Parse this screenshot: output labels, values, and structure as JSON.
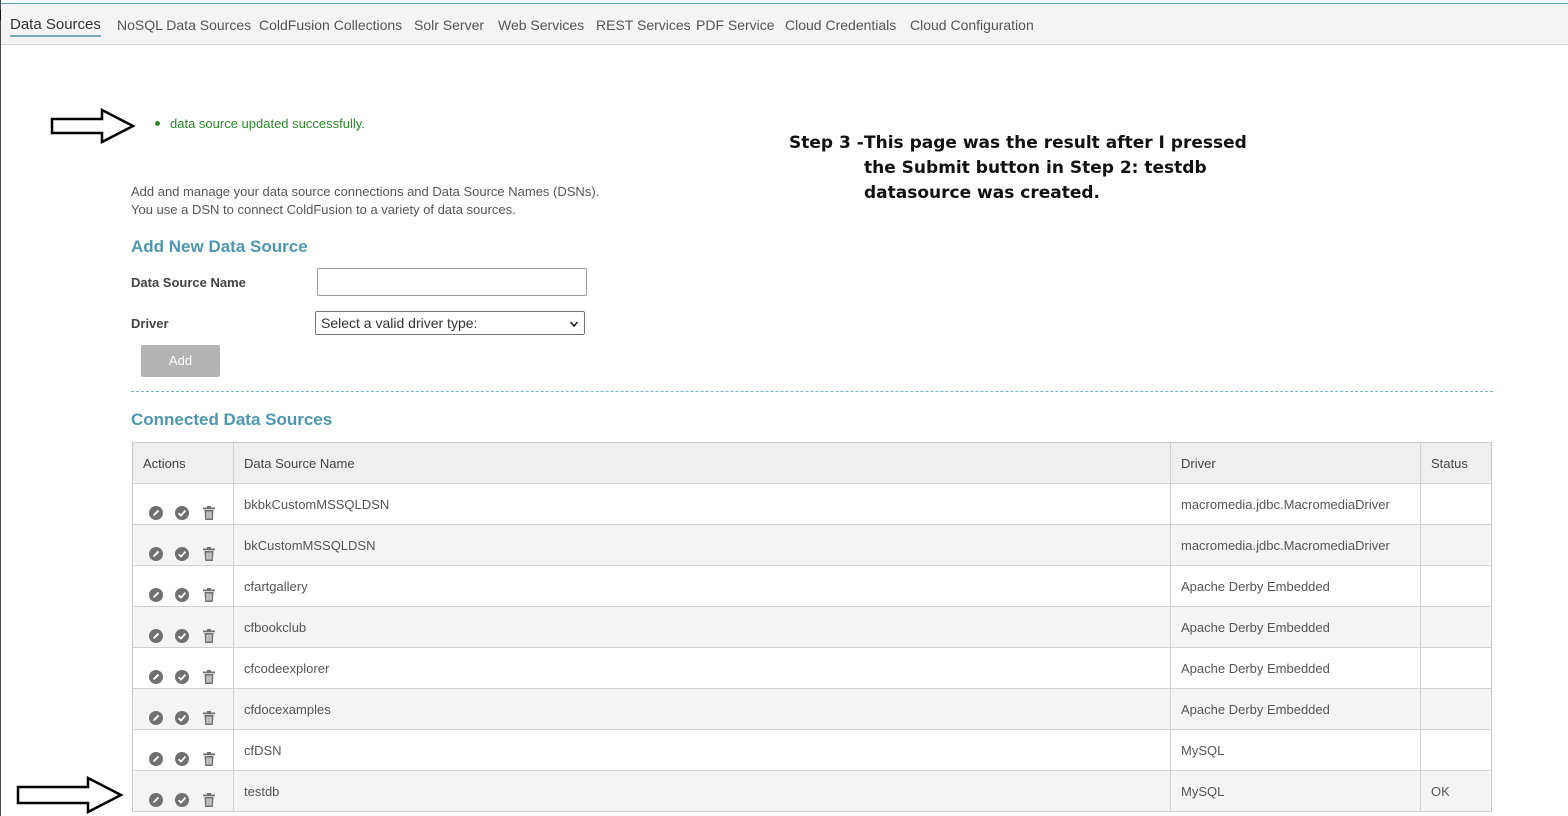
{
  "nav": {
    "tabs": [
      {
        "label": "Data Sources",
        "active": true
      },
      {
        "label": "NoSQL Data Sources"
      },
      {
        "label": "ColdFusion Collections"
      },
      {
        "label": "Solr Server"
      },
      {
        "label": "Web Services"
      },
      {
        "label": "REST Services"
      },
      {
        "label": "PDF Service"
      },
      {
        "label": "Cloud Credentials"
      },
      {
        "label": "Cloud Configuration"
      }
    ]
  },
  "message": {
    "success": "data source updated successfully."
  },
  "annotation": {
    "prefix": "Step 3 -",
    "text": "This page was the result after I pressed the Submit button in Step 2: testdb datasource was created."
  },
  "intro": {
    "line1": "Add and manage your data source connections and Data Source Names (DSNs).",
    "line2": "You use a DSN to connect ColdFusion to a variety of data sources."
  },
  "add_form": {
    "title": "Add New Data Source",
    "name_label": "Data Source Name",
    "name_value": "",
    "driver_label": "Driver",
    "driver_selected": "Select a valid driver type:",
    "add_button": "Add"
  },
  "connected": {
    "title": "Connected Data Sources",
    "columns": [
      "Actions",
      "Data Source Name",
      "Driver",
      "Status"
    ],
    "rows": [
      {
        "name": "bkbkCustomMSSQLDSN",
        "driver": "macromedia.jdbc.MacromediaDriver",
        "status": ""
      },
      {
        "name": "bkCustomMSSQLDSN",
        "driver": "macromedia.jdbc.MacromediaDriver",
        "status": ""
      },
      {
        "name": "cfartgallery",
        "driver": "Apache Derby Embedded",
        "status": ""
      },
      {
        "name": "cfbookclub",
        "driver": "Apache Derby Embedded",
        "status": ""
      },
      {
        "name": "cfcodeexplorer",
        "driver": "Apache Derby Embedded",
        "status": ""
      },
      {
        "name": "cfdocexamples",
        "driver": "Apache Derby Embedded",
        "status": ""
      },
      {
        "name": "cfDSN",
        "driver": "MySQL",
        "status": ""
      },
      {
        "name": "testdb",
        "driver": "MySQL",
        "status": "OK"
      }
    ]
  },
  "icons": {
    "row_actions": [
      "edit-icon",
      "verify-icon",
      "delete-icon"
    ],
    "pointer": "arrow-right-icon"
  },
  "colors": {
    "accent": "#4f97b0",
    "success": "#2a8a2a",
    "button_disabled": "#b3b3b3"
  }
}
